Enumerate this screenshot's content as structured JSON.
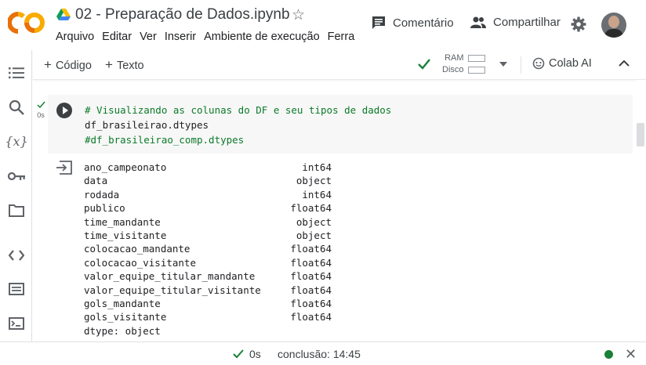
{
  "app": {
    "logo_text": "CO",
    "notebook_title": "02 - Preparação de Dados.ipynb"
  },
  "menu": [
    "Arquivo",
    "Editar",
    "Ver",
    "Inserir",
    "Ambiente de execução",
    "Ferra"
  ],
  "header_actions": {
    "comment_label": "Comentário",
    "share_label": "Compartilhar"
  },
  "toolbar": {
    "add_code_label": "Código",
    "add_text_label": "Texto",
    "ram_label": "RAM",
    "disk_label": "Disco",
    "colab_ai_label": "Colab AI"
  },
  "cell": {
    "exec_time": "0s",
    "code_lines": [
      "# Visualizando as colunas do DF e seu tipos de dados",
      "df_brasileirao.dtypes",
      "#df_brasileirao_comp.dtypes"
    ]
  },
  "output": {
    "rows": [
      {
        "name": "ano_campeonato",
        "dtype": "int64"
      },
      {
        "name": "data",
        "dtype": "object"
      },
      {
        "name": "rodada",
        "dtype": "int64"
      },
      {
        "name": "publico",
        "dtype": "float64"
      },
      {
        "name": "time_mandante",
        "dtype": "object"
      },
      {
        "name": "time_visitante",
        "dtype": "object"
      },
      {
        "name": "colocacao_mandante",
        "dtype": "float64"
      },
      {
        "name": "colocacao_visitante",
        "dtype": "float64"
      },
      {
        "name": "valor_equipe_titular_mandante",
        "dtype": "float64"
      },
      {
        "name": "valor_equipe_titular_visitante",
        "dtype": "float64"
      },
      {
        "name": "gols_mandante",
        "dtype": "float64"
      },
      {
        "name": "gols_visitante",
        "dtype": "float64"
      }
    ],
    "footer": "dtype: object"
  },
  "statusbar": {
    "time": "0s",
    "completion": "conclusão: 14:45"
  },
  "colors": {
    "logo_orange": "#F9AB00",
    "logo_dark_orange": "#E8710A",
    "success_green": "#188038",
    "comment_green": "#0B7A28"
  }
}
